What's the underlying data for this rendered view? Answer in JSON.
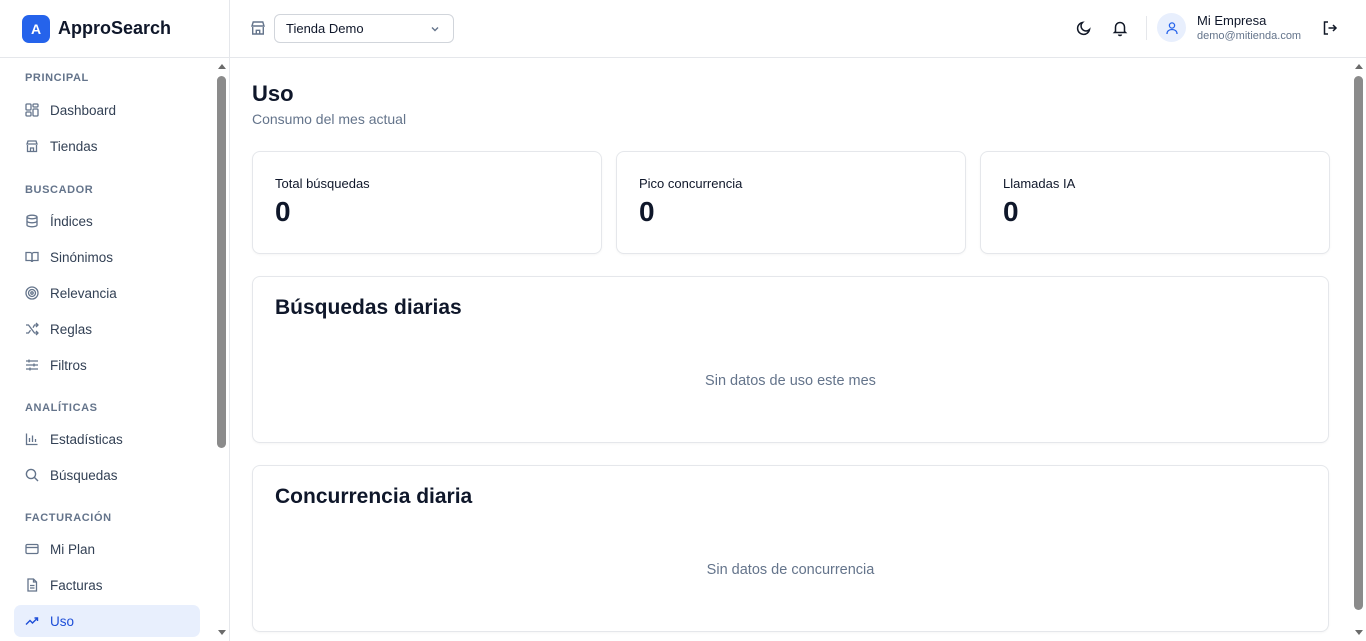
{
  "brand": {
    "logo_letter": "A",
    "name": "ApproSearch",
    "accent": "#2563eb"
  },
  "sidebar": {
    "sections": [
      {
        "title": "PRINCIPAL",
        "items": [
          {
            "label": "Dashboard",
            "icon": "dashboard-icon"
          },
          {
            "label": "Tiendas",
            "icon": "store-icon"
          }
        ]
      },
      {
        "title": "BUSCADOR",
        "items": [
          {
            "label": "Índices",
            "icon": "database-icon"
          },
          {
            "label": "Sinónimos",
            "icon": "book-icon"
          },
          {
            "label": "Relevancia",
            "icon": "target-icon"
          },
          {
            "label": "Reglas",
            "icon": "shuffle-icon"
          },
          {
            "label": "Filtros",
            "icon": "sliders-icon"
          }
        ]
      },
      {
        "title": "ANALÍTICAS",
        "items": [
          {
            "label": "Estadísticas",
            "icon": "bar-chart-icon"
          },
          {
            "label": "Búsquedas",
            "icon": "search-icon"
          }
        ]
      },
      {
        "title": "FACTURACIÓN",
        "items": [
          {
            "label": "Mi Plan",
            "icon": "credit-card-icon"
          },
          {
            "label": "Facturas",
            "icon": "file-icon"
          },
          {
            "label": "Uso",
            "icon": "trending-up-icon",
            "active": true
          }
        ]
      }
    ]
  },
  "header": {
    "store_select": {
      "value": "Tienda Demo"
    },
    "user": {
      "name": "Mi Empresa",
      "email": "demo@mitienda.com"
    }
  },
  "main": {
    "title": "Uso",
    "subtitle": "Consumo del mes actual",
    "stats": [
      {
        "label": "Total búsquedas",
        "value": "0"
      },
      {
        "label": "Pico concurrencia",
        "value": "0"
      },
      {
        "label": "Llamadas IA",
        "value": "0"
      }
    ],
    "daily_searches": {
      "title": "Búsquedas diarias",
      "empty": "Sin datos de uso este mes"
    },
    "daily_concurrency": {
      "title": "Concurrencia diaria",
      "empty": "Sin datos de concurrencia"
    }
  }
}
